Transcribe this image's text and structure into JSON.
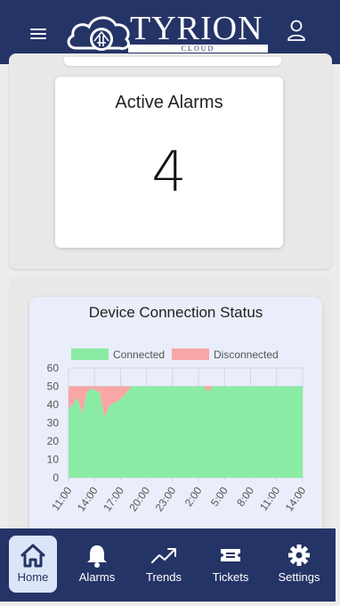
{
  "header": {
    "logo_title": "TYRION",
    "logo_subtitle": "CLOUD",
    "menu_icon": "hamburger-icon",
    "user_icon": "user-icon"
  },
  "alarms": {
    "title": "Active Alarms",
    "count": "4"
  },
  "chart": {
    "title": "Device Connection Status"
  },
  "chart_data": {
    "type": "area",
    "title": "Device Connection Status",
    "xlabel": "",
    "ylabel": "",
    "ylim": [
      0,
      60
    ],
    "yticks": [
      "0",
      "10",
      "20",
      "30",
      "40",
      "50",
      "60"
    ],
    "xtick_labels": [
      "11:00",
      "14:00",
      "17:00",
      "20:00",
      "23:00",
      "2:00",
      "5:00",
      "8:00",
      "11:00",
      "14:00"
    ],
    "x": [
      0,
      1,
      2,
      3,
      4,
      5,
      6,
      7,
      8,
      9,
      10,
      11,
      12,
      13,
      14,
      15,
      16,
      17,
      18,
      19,
      20,
      21,
      22,
      23,
      24,
      25,
      26,
      27,
      28,
      29,
      30,
      31,
      32,
      33,
      34,
      35,
      36,
      37,
      38,
      39,
      40,
      41,
      42,
      43,
      44,
      45,
      46,
      47,
      48,
      49,
      50,
      51,
      52
    ],
    "legend_position": "top",
    "grid": true,
    "series": [
      {
        "name": "Connected",
        "color": "#8aeca4",
        "values": [
          38,
          40,
          44,
          35,
          46,
          49,
          48,
          46,
          33,
          39,
          41,
          42,
          44,
          47,
          50,
          50,
          50,
          50,
          50,
          50,
          50,
          50,
          50,
          50,
          50,
          50,
          50,
          50,
          50,
          50,
          50,
          47,
          50,
          50,
          50,
          50,
          50,
          50,
          50,
          50,
          50,
          50,
          50,
          50,
          50,
          50,
          50,
          50,
          50,
          50,
          50,
          50,
          50
        ]
      },
      {
        "name": "Disconnected",
        "color": "#f8a6a6",
        "values": [
          12,
          10,
          6,
          15,
          4,
          1,
          2,
          4,
          17,
          11,
          9,
          8,
          6,
          3,
          0,
          0,
          0,
          0,
          0,
          0,
          0,
          0,
          0,
          0,
          0,
          0,
          0,
          0,
          0,
          0,
          0,
          3,
          0,
          0,
          0,
          0,
          0,
          0,
          0,
          0,
          0,
          0,
          0,
          0,
          0,
          0,
          0,
          0,
          0,
          0,
          0,
          0,
          0
        ]
      }
    ]
  },
  "nav": {
    "items": [
      {
        "label": "Home",
        "icon": "home-icon",
        "active": true
      },
      {
        "label": "Alarms",
        "icon": "bell-icon",
        "active": false
      },
      {
        "label": "Trends",
        "icon": "trending-up-icon",
        "active": false
      },
      {
        "label": "Tickets",
        "icon": "ticket-icon",
        "active": false
      },
      {
        "label": "Settings",
        "icon": "gear-icon",
        "active": false
      }
    ]
  },
  "colors": {
    "header_bg": "#253466",
    "nav_active_bg": "#dce4f7",
    "connected": "#8aeca4",
    "disconnected": "#f8a6a6"
  }
}
